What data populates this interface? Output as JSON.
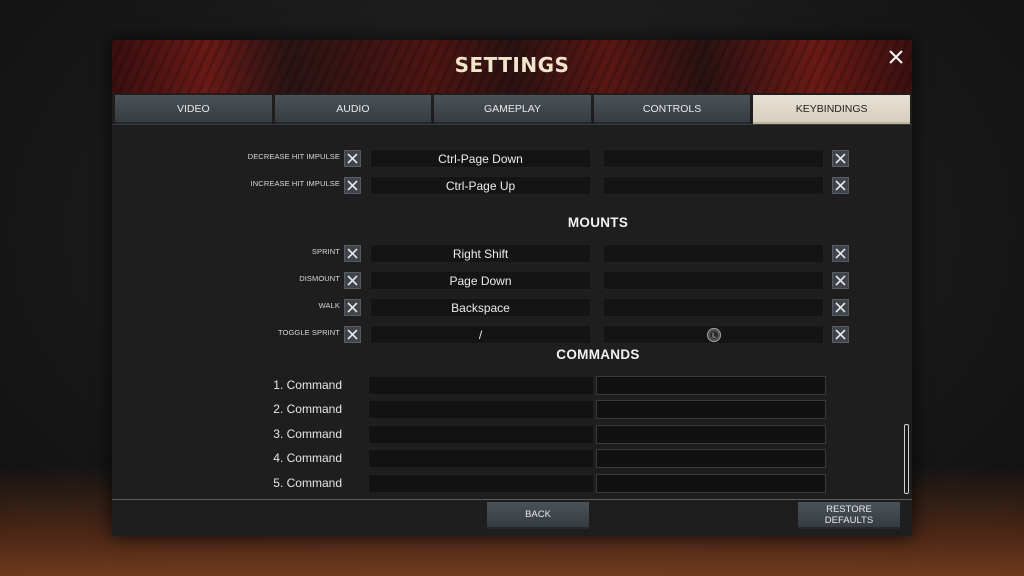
{
  "title": "SETTINGS",
  "tabs": [
    "VIDEO",
    "AUDIO",
    "GAMEPLAY",
    "CONTROLS",
    "KEYBINDINGS"
  ],
  "active_tab": "KEYBINDINGS",
  "hit_impulse_rows": [
    {
      "label": "DECREASE HIT IMPULSE",
      "primary": "Ctrl-Page Down",
      "secondary": ""
    },
    {
      "label": "INCREASE HIT IMPULSE",
      "primary": "Ctrl-Page Up",
      "secondary": ""
    }
  ],
  "mounts": {
    "title": "MOUNTS",
    "rows": [
      {
        "label": "SPRINT",
        "primary": "Right Shift",
        "secondary": ""
      },
      {
        "label": "DISMOUNT",
        "primary": "Page Down",
        "secondary": ""
      },
      {
        "label": "WALK",
        "primary": "Backspace",
        "secondary": ""
      },
      {
        "label": "TOGGLE SPRINT",
        "primary": "/",
        "secondary": "gamepad-L-icon"
      }
    ]
  },
  "commands": {
    "title": "COMMANDS",
    "rows": [
      {
        "label": "1. Command",
        "value": "",
        "binding": ""
      },
      {
        "label": "2. Command",
        "value": "",
        "binding": ""
      },
      {
        "label": "3. Command",
        "value": "",
        "binding": ""
      },
      {
        "label": "4. Command",
        "value": "",
        "binding": ""
      },
      {
        "label": "5. Command",
        "value": "",
        "binding": ""
      }
    ]
  },
  "footer": {
    "back_label": "BACK",
    "restore_label_line1": "RESTORE",
    "restore_label_line2": "DEFAULTS"
  },
  "icons": {
    "close": "close-icon",
    "clear": "clear-x-icon",
    "gamepad": "gamepad-L-icon"
  },
  "colors": {
    "header_red": "#6a1a16",
    "tab_active_bg": "#e2dccd",
    "tab_bg": "#40474d",
    "field_bg": "#141414",
    "accent_text": "#f1e6cc"
  }
}
